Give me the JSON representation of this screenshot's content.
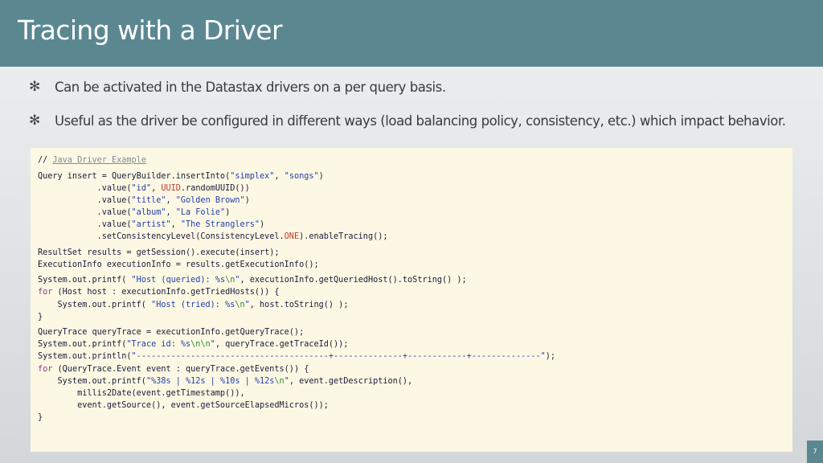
{
  "slide": {
    "title": "Tracing with a Driver",
    "bullet_glyph": "✻",
    "bullets": [
      "Can be activated in the Datastax drivers on a per query basis.",
      "Useful as the driver be configured in different ways (load balancing policy, consistency, etc.) which impact behavior."
    ],
    "page_number": "7"
  },
  "code": {
    "lines": [
      "// Java Driver Example",
      "",
      "Query insert = QueryBuilder.insertInto(\"simplex\", \"songs\")",
      "            .value(\"id\", UUID.randomUUID())",
      "            .value(\"title\", \"Golden Brown\")",
      "            .value(\"album\", \"La Folie\")",
      "            .value(\"artist\", \"The Stranglers\")",
      "            .setConsistencyLevel(ConsistencyLevel.ONE).enableTracing();",
      "",
      "ResultSet results = getSession().execute(insert);",
      "ExecutionInfo executionInfo = results.getExecutionInfo();",
      "",
      "System.out.printf( \"Host (queried): %s\\n\", executionInfo.getQueriedHost().toString() );",
      "for (Host host : executionInfo.getTriedHosts()) {",
      "    System.out.printf( \"Host (tried): %s\\n\", host.toString() );",
      "}",
      "",
      "QueryTrace queryTrace = executionInfo.getQueryTrace();",
      "System.out.printf(\"Trace id: %s\\n\\n\", queryTrace.getTraceId());",
      "System.out.println(\"---------------------------------------+--------------+------------+--------------\");",
      "for (QueryTrace.Event event : queryTrace.getEvents()) {",
      "    System.out.printf(\"%38s | %12s | %10s | %12s\\n\", event.getDescription(),",
      "        millis2Date(event.getTimestamp()),",
      "        event.getSource(), event.getSourceElapsedMicros());",
      "}"
    ]
  },
  "colors": {
    "header_bg": "#5b8791",
    "code_bg": "#fdf8e3",
    "keyword": "#8a3b88",
    "string": "#1f3fae",
    "escape": "#2c8a3f",
    "comment": "#7d8a99",
    "constant": "#c0392b"
  }
}
